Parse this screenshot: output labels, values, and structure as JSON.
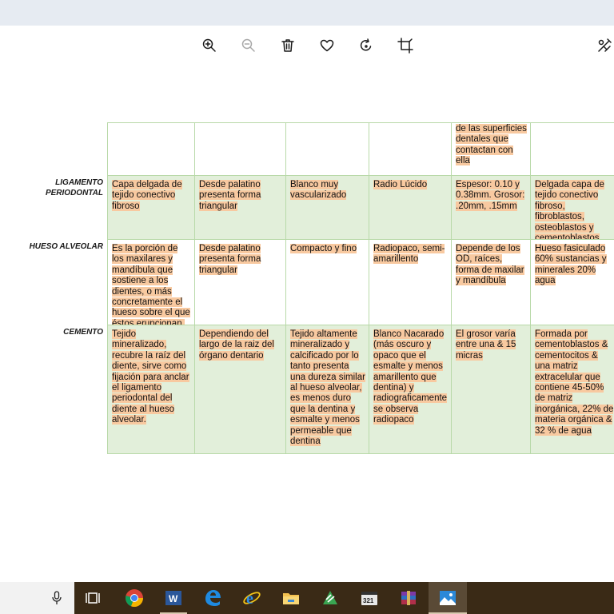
{
  "toolbar": {
    "buttons": [
      "zoom-in",
      "zoom-out",
      "delete",
      "favorite",
      "rotate",
      "crop",
      "edit"
    ]
  },
  "table": {
    "columns_count": 6,
    "rows": [
      {
        "label": "",
        "cells": [
          "",
          "",
          "",
          "",
          "de las superficies dentales que contactan con ella",
          ""
        ]
      },
      {
        "label": "LIGAMENTO PERIODONTAL",
        "cells": [
          "Capa delgada de tejido conectivo fibroso",
          "Desde palatino presenta forma triangular",
          "Blanco muy vascularizado",
          "Radio Lúcido",
          "Espesor: 0.10 y 0.38mm. Grosor: .20mm, .15mm",
          "Delgada capa de tejido conectivo fibroso, fibroblastos, osteoblastos y cementoblastos"
        ]
      },
      {
        "label": "HUESO ALVEOLAR",
        "cells": [
          "Es la porción de los maxilares y mandíbula que sostiene a los dientes, o más concretamente el hueso sobre el que éstos erupcionan.",
          "Desde palatino presenta forma triangular",
          "Compacto y fino",
          "Radiopaco, semi-amarillento",
          "Depende de los OD, raíces, forma de maxilar y mandíbula",
          "Hueso fasiculado 60% sustancias y minerales 20% agua"
        ]
      },
      {
        "label": "CEMENTO",
        "cells": [
          "Tejido mineralizado, recubre la raíz del diente, sirve como fijación para anclar el ligamento periodontal del diente al hueso alveolar.",
          "Dependiendo del largo de la raiz del órgano dentario",
          "Tejido altamente mineralizado y calcificado por lo tanto presenta una dureza similar al hueso alveolar, es menos duro que la dentina y esmalte y menos permeable que dentina",
          "Blanco Nacarado (más oscuro y opaco que el esmalte y menos amarillento que dentina) y radiograficamente se observa radiopaco",
          "El grosor varía entre una & 15 micras",
          "Formada por cementoblastos & cementocitos & una matriz extracelular que contiene 45-50% de matriz inorgánica, 22% de materia orgánica & 32 % de agua"
        ]
      }
    ]
  },
  "taskbar": {
    "apps": [
      "microphone",
      "task-view",
      "chrome",
      "word",
      "edge",
      "internet-explorer",
      "file-explorer",
      "spreadsheet",
      "media-classic",
      "winrar",
      "photos"
    ]
  },
  "colors": {
    "cell_shade": "#e2efda",
    "highlight": "#f8c9a0",
    "border": "#b8d9a8",
    "taskbar": "#3a2a16"
  }
}
